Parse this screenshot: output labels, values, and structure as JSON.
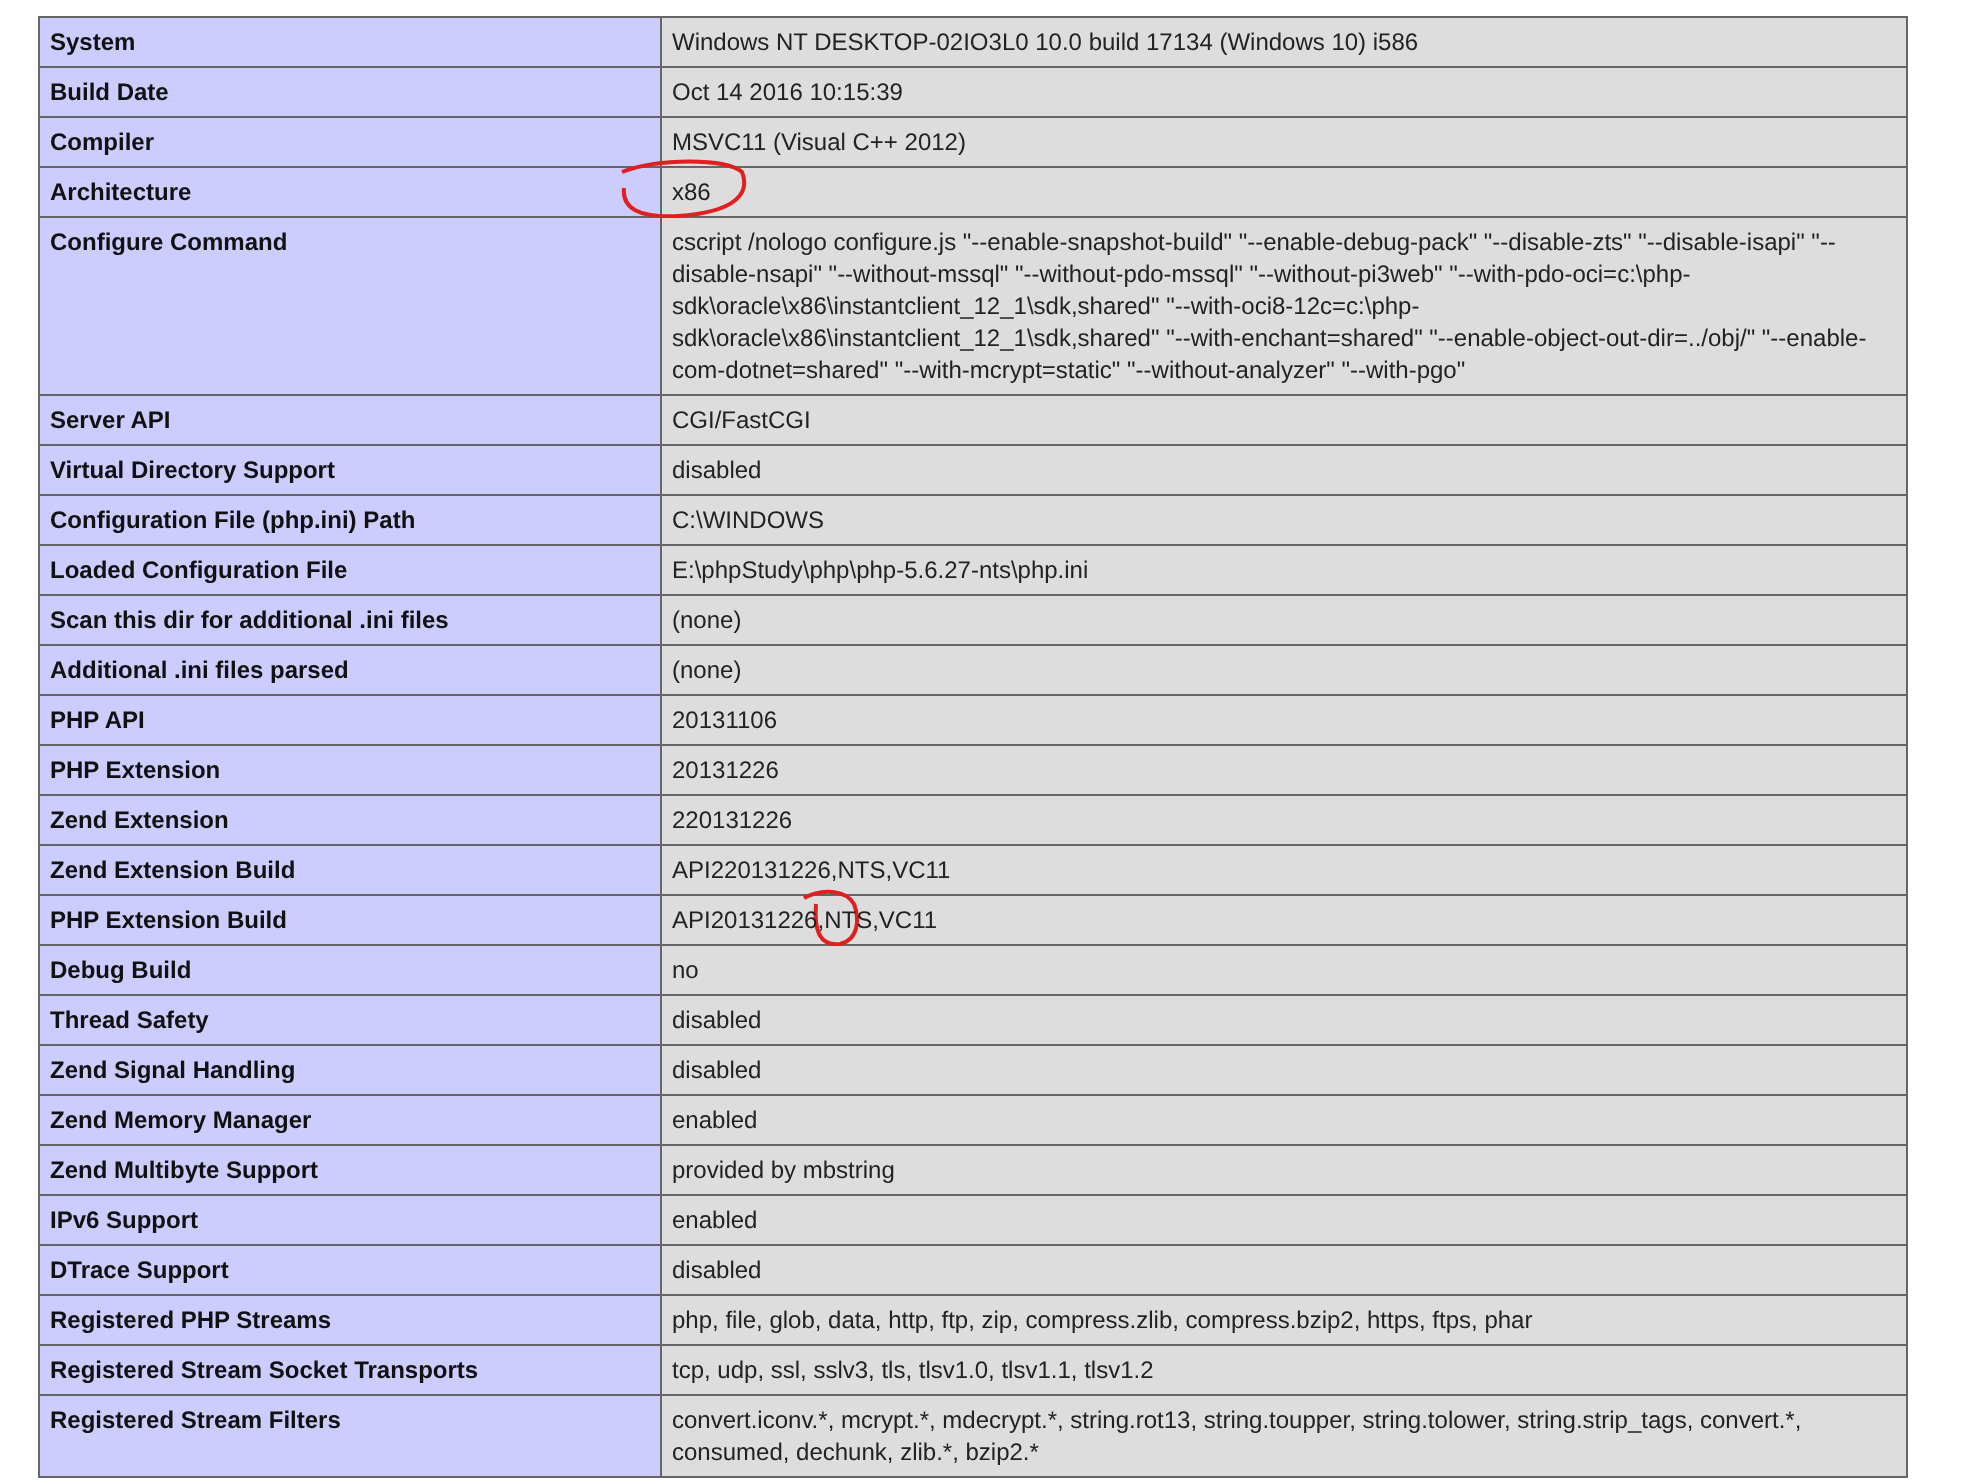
{
  "rows": [
    {
      "label": "System",
      "value": "Windows NT DESKTOP-02IO3L0 10.0 build 17134 (Windows 10) i586"
    },
    {
      "label": "Build Date",
      "value": "Oct 14 2016 10:15:39"
    },
    {
      "label": "Compiler",
      "value": "MSVC11 (Visual C++ 2012)"
    },
    {
      "label": "Architecture",
      "value": "x86",
      "circled": true
    },
    {
      "label": "Configure Command",
      "value": "cscript /nologo configure.js \"--enable-snapshot-build\" \"--enable-debug-pack\" \"--disable-zts\" \"--disable-isapi\" \"--disable-nsapi\" \"--without-mssql\" \"--without-pdo-mssql\" \"--without-pi3web\" \"--with-pdo-oci=c:\\php-sdk\\oracle\\x86\\instantclient_12_1\\sdk,shared\" \"--with-oci8-12c=c:\\php-sdk\\oracle\\x86\\instantclient_12_1\\sdk,shared\" \"--with-enchant=shared\" \"--enable-object-out-dir=../obj/\" \"--enable-com-dotnet=shared\" \"--with-mcrypt=static\" \"--without-analyzer\" \"--with-pgo\""
    },
    {
      "label": "Server API",
      "value": "CGI/FastCGI"
    },
    {
      "label": "Virtual Directory Support",
      "value": "disabled"
    },
    {
      "label": "Configuration File (php.ini) Path",
      "value": "C:\\WINDOWS"
    },
    {
      "label": "Loaded Configuration File",
      "value": "E:\\phpStudy\\php\\php-5.6.27-nts\\php.ini"
    },
    {
      "label": "Scan this dir for additional .ini files",
      "value": "(none)"
    },
    {
      "label": "Additional .ini files parsed",
      "value": "(none)"
    },
    {
      "label": "PHP API",
      "value": "20131106"
    },
    {
      "label": "PHP Extension",
      "value": "20131226"
    },
    {
      "label": "Zend Extension",
      "value": "220131226"
    },
    {
      "label": "Zend Extension Build",
      "value": "API220131226,NTS,VC11"
    },
    {
      "label": "PHP Extension Build",
      "value": "API20131226,NTS,VC11",
      "circled": true
    },
    {
      "label": "Debug Build",
      "value": "no"
    },
    {
      "label": "Thread Safety",
      "value": "disabled"
    },
    {
      "label": "Zend Signal Handling",
      "value": "disabled"
    },
    {
      "label": "Zend Memory Manager",
      "value": "enabled"
    },
    {
      "label": "Zend Multibyte Support",
      "value": "provided by mbstring"
    },
    {
      "label": "IPv6 Support",
      "value": "enabled"
    },
    {
      "label": "DTrace Support",
      "value": "disabled"
    },
    {
      "label": "Registered PHP Streams",
      "value": "php, file, glob, data, http, ftp, zip, compress.zlib, compress.bzip2, https, ftps, phar"
    },
    {
      "label": "Registered Stream Socket Transports",
      "value": "tcp, udp, ssl, sslv3, tls, tlsv1.0, tlsv1.1, tlsv1.2"
    },
    {
      "label": "Registered Stream Filters",
      "value": "convert.iconv.*, mcrypt.*, mdecrypt.*, string.rot13, string.toupper, string.tolower, string.strip_tags, convert.*, consumed, dechunk, zlib.*, bzip2.*"
    }
  ]
}
